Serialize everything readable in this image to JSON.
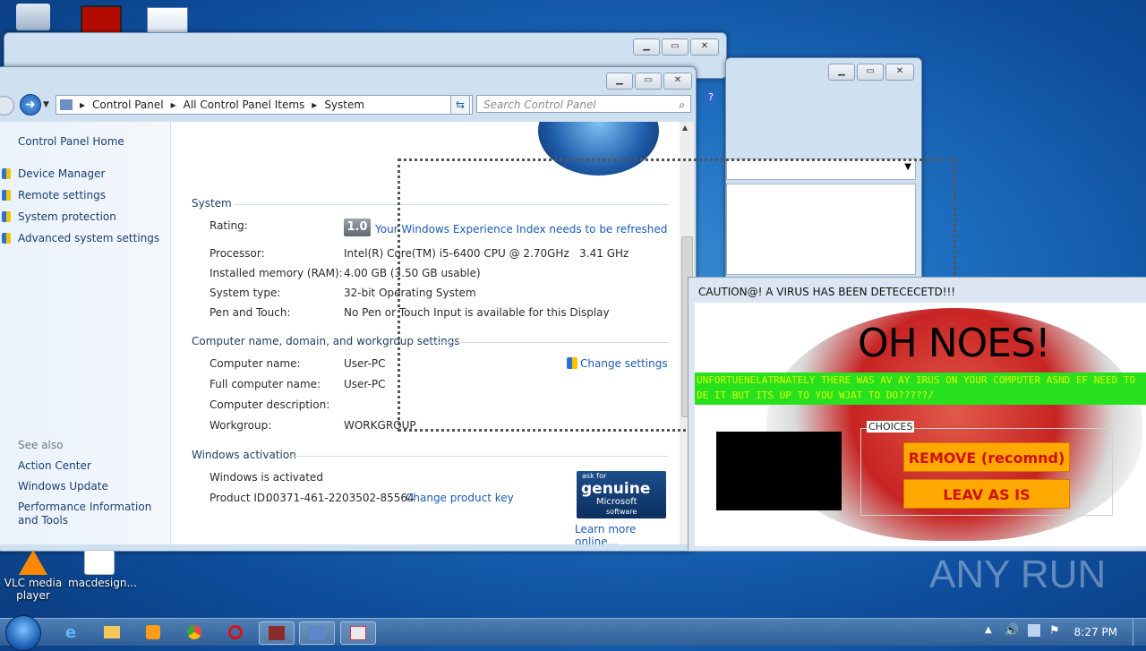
{
  "desktop": {
    "icons": [
      {
        "label": "VLC media player"
      },
      {
        "label": "macdesign..."
      }
    ],
    "watermark": "ANY RUN"
  },
  "control_panel": {
    "breadcrumb": [
      "Control Panel",
      "All Control Panel Items",
      "System"
    ],
    "search_placeholder": "Search Control Panel",
    "left": {
      "home": "Control Panel Home",
      "links": [
        "Device Manager",
        "Remote settings",
        "System protection",
        "Advanced system settings"
      ],
      "see_also_heading": "See also",
      "see_also": [
        "Action Center",
        "Windows Update",
        "Performance Information and Tools"
      ]
    },
    "system": {
      "heading": "System",
      "rating_label": "Rating:",
      "rating_value": "1.0",
      "rating_link": "Your Windows Experience Index needs to be refreshed",
      "processor_label": "Processor:",
      "processor_value": "Intel(R) Core(TM) i5-6400 CPU @ 2.70GHz   3.41 GHz",
      "memory_label": "Installed memory (RAM):",
      "memory_value": "4.00 GB (3.50 GB usable)",
      "type_label": "System type:",
      "type_value": "32-bit Operating System",
      "pen_label": "Pen and Touch:",
      "pen_value": "No Pen or Touch Input is available for this Display"
    },
    "computer": {
      "heading": "Computer name, domain, and workgroup settings",
      "name_label": "Computer name:",
      "name_value": "User-PC",
      "full_label": "Full computer name:",
      "full_value": "User-PC",
      "desc_label": "Computer description:",
      "workgroup_label": "Workgroup:",
      "workgroup_value": "WORKGROUP",
      "change_settings": "Change settings"
    },
    "activation": {
      "heading": "Windows activation",
      "status": "Windows is activated",
      "product_id_label": "Product ID:",
      "product_id": "00371-461-2203502-85564",
      "change_key": "Change product key",
      "genuine_top": "ask for",
      "genuine_main": "genuine",
      "genuine_brand": "Microsoft",
      "genuine_sub": "software",
      "learn_more": "Learn more online..."
    }
  },
  "popup": {
    "title": "CAUTION@! A VIRUS HAS BEEN DETECECETD!!!",
    "headline": "OH NOES!",
    "banner_line1": "UNFORTUENELATRNATELY THERE WAS AV AY IRUS ON YOUR COMPUTER ASND EF NEED TO",
    "banner_line2": "DE IT BUT ITS UP TO YOU WJAT TO DO?????/",
    "choices_legend": "CHOICES",
    "remove_button": "REMOVE (recomnd)",
    "leave_button": "LEAV AS IS"
  },
  "taskbar": {
    "time": "8:27 PM"
  }
}
